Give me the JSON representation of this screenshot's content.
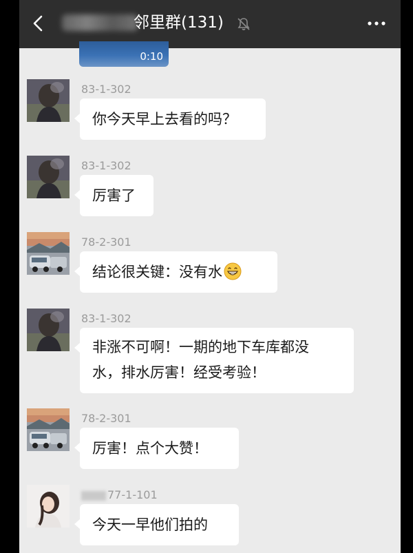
{
  "header": {
    "title": "邻里群(131)",
    "mute": "mute-icon",
    "more": "more-icon",
    "back": "back-icon"
  },
  "video": {
    "duration": "0:10"
  },
  "messages": [
    {
      "sender": "83-1-302",
      "text": "你今天早上去看的吗？",
      "avatar": "woman-back-avatar"
    },
    {
      "sender": "83-1-302",
      "text": "厉害了",
      "avatar": "woman-back-avatar"
    },
    {
      "sender": "78-2-301",
      "text": "结论很关键：没有水",
      "avatar": "cars-landscape-avatar",
      "emoji": "grinning-face-icon"
    },
    {
      "sender": "83-1-302",
      "line1": "非涨不可啊！一期的地下车库都没",
      "line2": "水，排水厉害！经受考验！",
      "avatar": "woman-back-avatar"
    },
    {
      "sender": "78-2-301",
      "text": "厉害！点个大赞！",
      "avatar": "cars-landscape-avatar"
    },
    {
      "sender": "77-1-101",
      "text": "今天一早他们拍的",
      "avatar": "girl-portrait-avatar"
    }
  ],
  "colors": {
    "header_bg": "#2e2e2e",
    "chat_bg": "#ebebeb",
    "bubble_bg": "#ffffff",
    "sender_text": "#9b9b9b"
  }
}
